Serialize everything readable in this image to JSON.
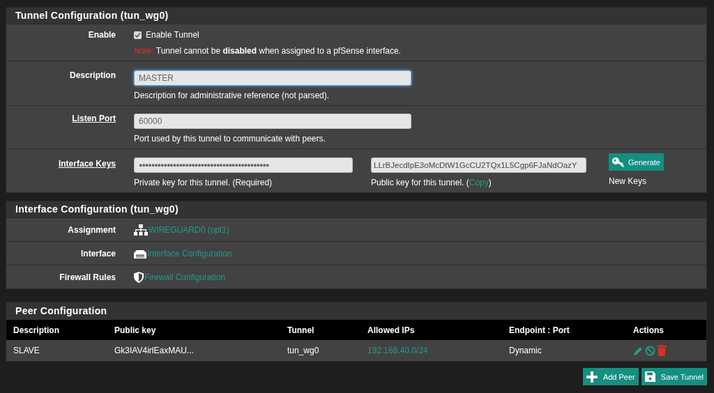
{
  "tunnel_panel": {
    "title": "Tunnel Configuration (tun_wg0)",
    "enable": {
      "label": "Enable",
      "checkbox_label": "Enable Tunnel",
      "checked": true,
      "note_label": "Note:",
      "note": "Tunnel cannot be **disabled** when assigned to a pfSense interface."
    },
    "description": {
      "label": "Description",
      "value": "MASTER",
      "focused": true,
      "help": "Description for administrative reference (not parsed)."
    },
    "listen_port": {
      "label": "Listen Port",
      "value": "60000",
      "help": "Port used by this tunnel to communicate with peers."
    },
    "interface_keys": {
      "label": "Interface Keys",
      "private_key": "●●●●●●●●●●●●●●●●●●●●●●●●●●●●●●●●●●●●●●●●●●",
      "private_help": "Private key for this tunnel. (Required)",
      "public_key": "LLrBJecdIpE3oMcDtW1GcCU2TQx1L5Cgp6FJaNdOazY",
      "public_help_before": "Public key for this tunnel. (",
      "copy_link": "Copy",
      "public_help_after": ")",
      "generate_button": "Generate",
      "generate_help": "New Keys"
    }
  },
  "interface_panel": {
    "title": "Interface Configuration (tun_wg0)",
    "rows": [
      {
        "label": "Assignment",
        "kind": "network",
        "link": "WIREGUARD0 (opt1)"
      },
      {
        "label": "Interface",
        "kind": "port",
        "link": "Interface Configuration"
      },
      {
        "label": "Firewall Rules",
        "kind": "shield",
        "link": "Firewall Configuration"
      }
    ]
  },
  "peer_panel": {
    "title": "Peer Configuration",
    "columns": [
      "Description",
      "Public key",
      "Tunnel",
      "Allowed IPs",
      "Endpoint : Port",
      "Actions"
    ],
    "rows": [
      {
        "description": "SLAVE",
        "public_key": "Gk3IAV4irlEaxMAU...",
        "tunnel": "tun_wg0",
        "allowed_ips": "192.168.40.0/24",
        "endpoint": "Dynamic"
      }
    ]
  },
  "buttons": [
    {
      "kind": "add",
      "label": "Add Peer"
    },
    {
      "kind": "save",
      "label": "Save Tunnel"
    }
  ]
}
